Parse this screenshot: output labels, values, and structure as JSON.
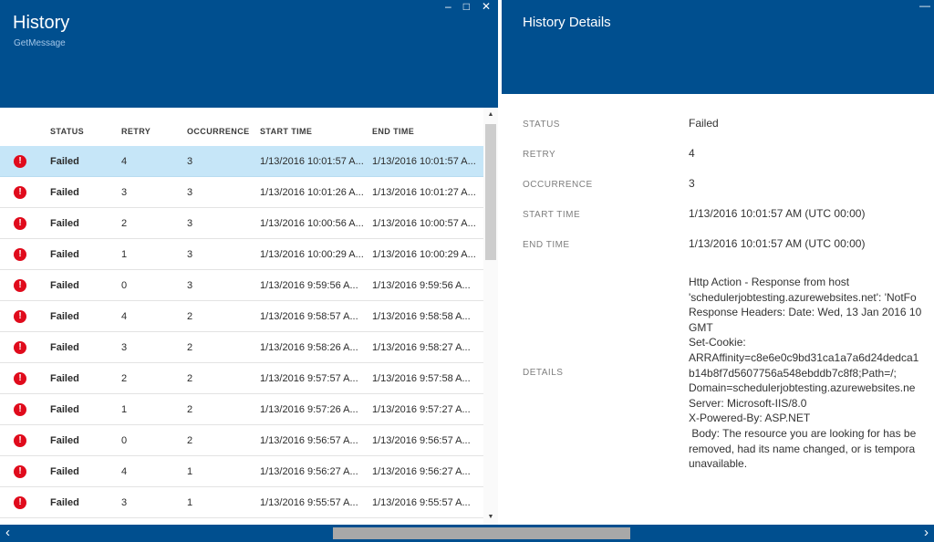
{
  "colors": {
    "header_blue": "#004f8f",
    "selected_row_blue": "#c6e6f8",
    "error_red": "#e00b1c",
    "scrollbar_thumb_gray": "#a8a8a8"
  },
  "icons": {
    "minimize": "–",
    "maximize": "□",
    "close": "✕",
    "blade_minimize": "—",
    "error": "!",
    "scroll_up": "▲",
    "scroll_down": "▼",
    "scroll_left": "‹",
    "scroll_right": "›"
  },
  "left_blade": {
    "title": "History",
    "subtitle": "GetMessage",
    "table": {
      "columns": [
        "STATUS",
        "RETRY",
        "OCCURRENCE",
        "START TIME",
        "END TIME"
      ],
      "rows": [
        {
          "selected": true,
          "status": "Failed",
          "retry": "4",
          "occurrence": "3",
          "start": "1/13/2016 10:01:57 A...",
          "end": "1/13/2016 10:01:57 A..."
        },
        {
          "selected": false,
          "status": "Failed",
          "retry": "3",
          "occurrence": "3",
          "start": "1/13/2016 10:01:26 A...",
          "end": "1/13/2016 10:01:27 A..."
        },
        {
          "selected": false,
          "status": "Failed",
          "retry": "2",
          "occurrence": "3",
          "start": "1/13/2016 10:00:56 A...",
          "end": "1/13/2016 10:00:57 A..."
        },
        {
          "selected": false,
          "status": "Failed",
          "retry": "1",
          "occurrence": "3",
          "start": "1/13/2016 10:00:29 A...",
          "end": "1/13/2016 10:00:29 A..."
        },
        {
          "selected": false,
          "status": "Failed",
          "retry": "0",
          "occurrence": "3",
          "start": "1/13/2016 9:59:56 A...",
          "end": "1/13/2016 9:59:56 A..."
        },
        {
          "selected": false,
          "status": "Failed",
          "retry": "4",
          "occurrence": "2",
          "start": "1/13/2016 9:58:57 A...",
          "end": "1/13/2016 9:58:58 A..."
        },
        {
          "selected": false,
          "status": "Failed",
          "retry": "3",
          "occurrence": "2",
          "start": "1/13/2016 9:58:26 A...",
          "end": "1/13/2016 9:58:27 A..."
        },
        {
          "selected": false,
          "status": "Failed",
          "retry": "2",
          "occurrence": "2",
          "start": "1/13/2016 9:57:57 A...",
          "end": "1/13/2016 9:57:58 A..."
        },
        {
          "selected": false,
          "status": "Failed",
          "retry": "1",
          "occurrence": "2",
          "start": "1/13/2016 9:57:26 A...",
          "end": "1/13/2016 9:57:27 A..."
        },
        {
          "selected": false,
          "status": "Failed",
          "retry": "0",
          "occurrence": "2",
          "start": "1/13/2016 9:56:57 A...",
          "end": "1/13/2016 9:56:57 A..."
        },
        {
          "selected": false,
          "status": "Failed",
          "retry": "4",
          "occurrence": "1",
          "start": "1/13/2016 9:56:27 A...",
          "end": "1/13/2016 9:56:27 A..."
        },
        {
          "selected": false,
          "status": "Failed",
          "retry": "3",
          "occurrence": "1",
          "start": "1/13/2016 9:55:57 A...",
          "end": "1/13/2016 9:55:57 A..."
        }
      ]
    }
  },
  "right_blade": {
    "title": "History Details",
    "fields": [
      {
        "label": "STATUS",
        "value": "Failed"
      },
      {
        "label": "RETRY",
        "value": "4"
      },
      {
        "label": "OCCURRENCE",
        "value": "3"
      },
      {
        "label": "START TIME",
        "value": "1/13/2016 10:01:57 AM (UTC 00:00)"
      },
      {
        "label": "END TIME",
        "value": "1/13/2016 10:01:57 AM (UTC 00:00)"
      }
    ],
    "details": {
      "label": "DETAILS",
      "lines": [
        "Http Action - Response from host",
        "'schedulerjobtesting.azurewebsites.net': 'NotFo",
        "Response Headers: Date: Wed, 13 Jan 2016 10",
        "GMT",
        "Set-Cookie:",
        "ARRAffinity=c8e6e0c9bd31ca1a7a6d24dedca1",
        "b14b8f7d5607756a548ebddb7c8f8;Path=/;",
        "Domain=schedulerjobtesting.azurewebsites.ne",
        "Server: Microsoft-IIS/8.0",
        "X-Powered-By: ASP.NET",
        " Body: The resource you are looking for has be",
        "removed, had its name changed, or is tempora",
        "unavailable."
      ]
    }
  }
}
